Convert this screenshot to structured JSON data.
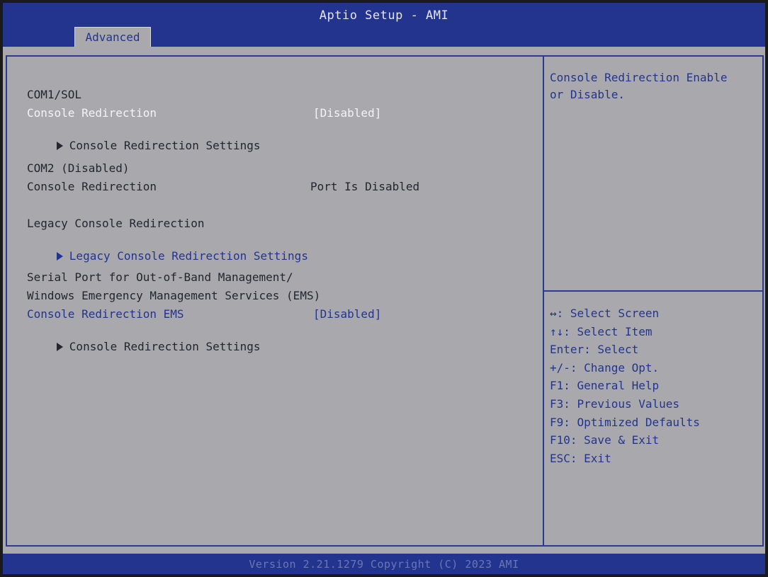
{
  "header": {
    "title": "Aptio Setup - AMI",
    "active_tab": "Advanced"
  },
  "main": {
    "com1": {
      "heading": "COM1/SOL",
      "console_redirection_label": "Console Redirection",
      "console_redirection_value": "[Disabled]",
      "settings_label": "Console Redirection Settings"
    },
    "com2": {
      "heading": "COM2 (Disabled)",
      "console_redirection_label": "Console Redirection",
      "console_redirection_value": "Port Is Disabled"
    },
    "legacy": {
      "heading": "Legacy Console Redirection",
      "settings_label": "Legacy Console Redirection Settings"
    },
    "ems": {
      "heading_line1": "Serial Port for Out-of-Band Management/",
      "heading_line2": "Windows Emergency Management Services (EMS)",
      "console_redirection_label": "Console Redirection EMS",
      "console_redirection_value": "[Disabled]",
      "settings_label": "Console Redirection Settings"
    }
  },
  "help": {
    "description": "Console Redirection Enable\nor Disable.",
    "keys": [
      "↔: Select Screen",
      "↑↓: Select Item",
      "Enter: Select",
      "+/-: Change Opt.",
      "F1: General Help",
      "F3: Previous Values",
      "F9: Optimized Defaults",
      "F10: Save & Exit",
      "ESC: Exit"
    ]
  },
  "footer": {
    "version": "Version 2.21.1279 Copyright (C) 2023 AMI"
  },
  "colors": {
    "header_bar": "#23348f",
    "body_background": "#a9a9ad",
    "selected_text": "#f4f4f8",
    "interactive_text": "#23348f",
    "static_text": "#23262e"
  }
}
